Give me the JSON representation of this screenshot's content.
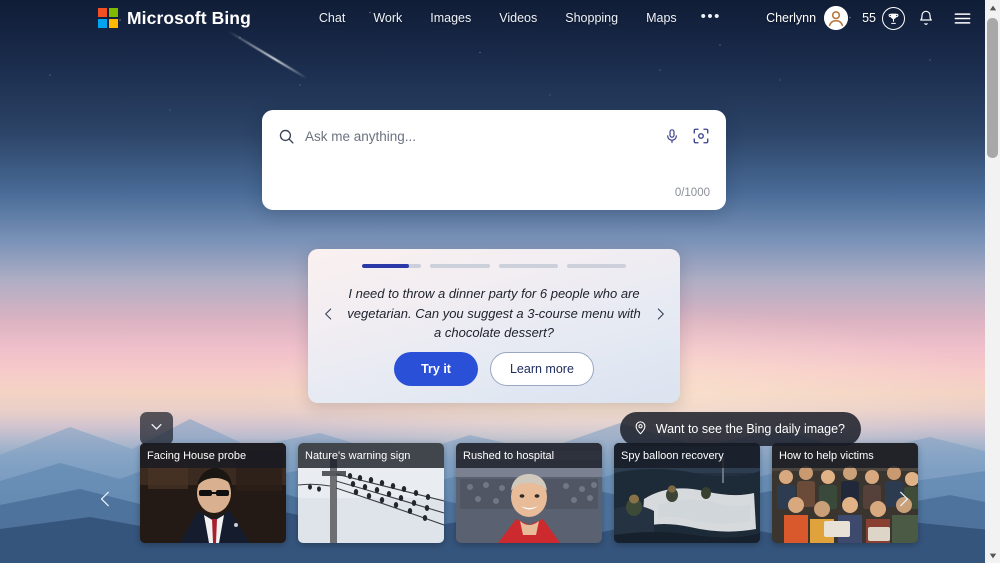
{
  "header": {
    "brand": "Microsoft Bing",
    "logo_colors": [
      "#f25022",
      "#7fba00",
      "#00a4ef",
      "#ffb900"
    ],
    "nav": [
      {
        "label": "Chat",
        "name": "nav-item-chat"
      },
      {
        "label": "Work",
        "name": "nav-item-work"
      },
      {
        "label": "Images",
        "name": "nav-item-images"
      },
      {
        "label": "Videos",
        "name": "nav-item-videos"
      },
      {
        "label": "Shopping",
        "name": "nav-item-shopping"
      },
      {
        "label": "Maps",
        "name": "nav-item-maps"
      }
    ],
    "more_label": "•••",
    "user_name": "Cherlynn",
    "rewards_count": "55",
    "icons": {
      "avatar": "user-avatar-icon",
      "rewards": "trophy-icon",
      "notifications": "bell-icon",
      "menu": "hamburger-menu-icon"
    }
  },
  "search": {
    "placeholder": "Ask me anything...",
    "value": "",
    "char_count": "0/1000",
    "icons": {
      "magnifier": "search-icon",
      "microphone": "microphone-icon",
      "lens": "visual-search-icon"
    }
  },
  "suggestion": {
    "progress": [
      80,
      0,
      0,
      0
    ],
    "accent": "#2b39a8",
    "text": "I need to throw a dinner party for 6 people who are vegetarian. Can you suggest a 3-course menu with a chocolate dessert?",
    "primary_button": "Try it",
    "secondary_button": "Learn more",
    "prev_icon": "chevron-left-icon",
    "next_icon": "chevron-right-icon"
  },
  "daily_image": {
    "label": "Want to see the Bing daily image?",
    "icon": "location-pin-icon"
  },
  "collapse": {
    "icon": "chevron-down-icon"
  },
  "carousel": {
    "prev_icon": "chevron-left-icon",
    "next_icon": "chevron-right-icon",
    "cards": [
      {
        "title": "Facing House probe",
        "name": "news-card-facing-house-probe"
      },
      {
        "title": "Nature's warning sign",
        "name": "news-card-natures-warning-sign"
      },
      {
        "title": "Rushed to hospital",
        "name": "news-card-rushed-to-hospital"
      },
      {
        "title": "Spy balloon recovery",
        "name": "news-card-spy-balloon-recovery"
      },
      {
        "title": "How to help victims",
        "name": "news-card-how-to-help-victims"
      }
    ]
  },
  "scrollbar": {
    "up_icon": "scroll-up-arrow-icon",
    "down_icon": "scroll-down-arrow-icon"
  }
}
